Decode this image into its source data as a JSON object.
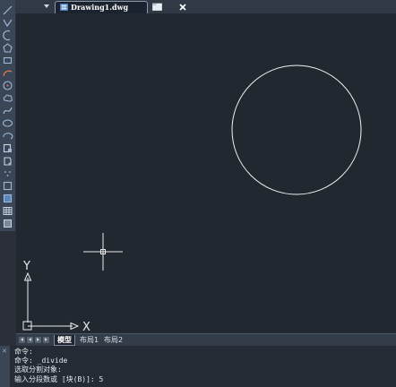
{
  "document_tab": {
    "name": "Drawing1.dwg"
  },
  "toolbar": {
    "tools": [
      "line-icon",
      "polyline-icon",
      "arc-icon",
      "polygon-icon",
      "rectangle-icon",
      "arc2-icon",
      "circle-icon",
      "cloud-icon",
      "spline-icon",
      "ellipse-icon",
      "ellipse-arc-icon",
      "insert-block-icon",
      "make-block-icon",
      "point-icon",
      "hatch-icon",
      "gradient-icon",
      "table-icon",
      "region-icon"
    ]
  },
  "canvas": {
    "axis_y_label": "Y",
    "axis_x_label": "X"
  },
  "layout_tabs": [
    "模型",
    "布局1",
    "布局2"
  ],
  "command_lines": [
    "命令:",
    "命令: _divide",
    "选取分割对象:",
    "输入分段数或 [块(B)]: 5"
  ],
  "colors": {
    "canvas_bg": "#212830",
    "toolbar_bg": "#3a4656",
    "circle_stroke": "#ffffff"
  }
}
